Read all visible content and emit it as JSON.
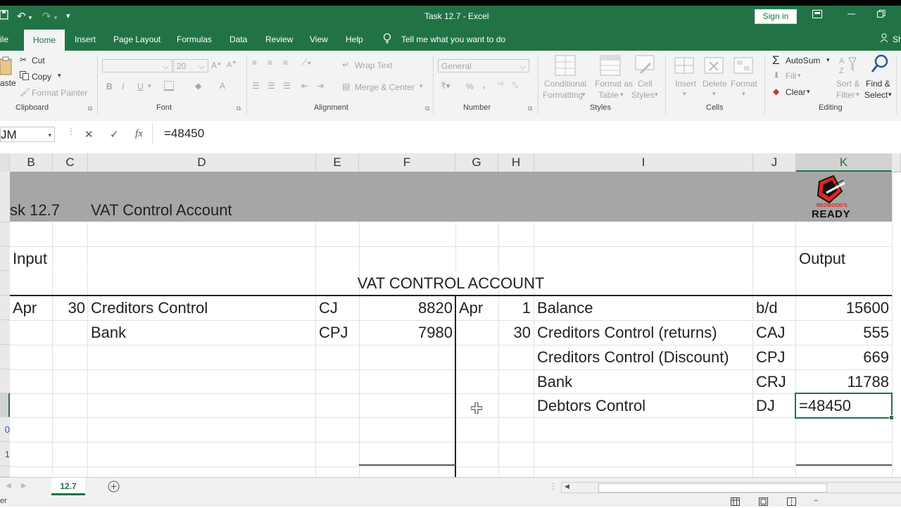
{
  "window": {
    "title": "Task 12.7  -  Excel",
    "sign_in": "Sign in"
  },
  "tabs": [
    "ile",
    "Home",
    "Insert",
    "Page Layout",
    "Formulas",
    "Data",
    "Review",
    "View",
    "Help"
  ],
  "tell_me": "Tell me what you want to do",
  "share": "Sh",
  "ribbon": {
    "paste": "aste",
    "cut": "Cut",
    "copy": "Copy",
    "format_painter": "Format Painter",
    "font_size": "20",
    "bold": "B",
    "italic": "I",
    "underline": "U",
    "wrap_text": "Wrap Text",
    "merge_center": "Merge & Center",
    "number_format": "General",
    "percent": "%",
    "comma": ",",
    "conditional": [
      "Conditional",
      "Formatting"
    ],
    "format_table": [
      "Format as",
      "Table"
    ],
    "cell_styles": [
      "Cell",
      "Styles"
    ],
    "insert": "Insert",
    "delete": "Delete",
    "format": "Format",
    "autosum": "AutoSum",
    "fill": "Fill",
    "clear": "Clear",
    "sort_filter": [
      "Sort &",
      "Filter"
    ],
    "find_select": [
      "Find &",
      "Select"
    ],
    "groups": [
      "Clipboard",
      "Font",
      "Alignment",
      "Number",
      "Styles",
      "Cells",
      "Editing"
    ]
  },
  "formula_bar": {
    "name_box": "JM",
    "formula": "=48450"
  },
  "columns": [
    "B",
    "C",
    "D",
    "E",
    "F",
    "G",
    "H",
    "I",
    "J",
    "K"
  ],
  "row_numbers": [
    "0",
    "1"
  ],
  "sheet": {
    "task_label": "sk 12.7",
    "task_title": "VAT Control Account",
    "logo_text": "REDWOOD'S",
    "logo_big": "READY",
    "input_label": "Input",
    "output_label": "Output",
    "account_heading": "VAT CONTROL ACCOUNT",
    "debit_rows": [
      {
        "month": "Apr",
        "day": "30",
        "details": "Creditors Control",
        "fol": "CJ",
        "amount": "8820"
      },
      {
        "month": "",
        "day": "",
        "details": "Bank",
        "fol": "CPJ",
        "amount": "7980"
      }
    ],
    "credit_rows": [
      {
        "month": "Apr",
        "day": "1",
        "details": "Balance",
        "fol": "b/d",
        "amount": "15600"
      },
      {
        "month": "",
        "day": "30",
        "details": "Creditors Control (returns)",
        "fol": "CAJ",
        "amount": "555"
      },
      {
        "month": "",
        "day": "",
        "details": "Creditors Control (Discount)",
        "fol": "CPJ",
        "amount": "669"
      },
      {
        "month": "",
        "day": "",
        "details": "Bank",
        "fol": "CRJ",
        "amount": "11788"
      },
      {
        "month": "",
        "day": "",
        "details": "Debtors Control",
        "fol": "DJ",
        "amount": "=48450"
      }
    ]
  },
  "sheet_tabs": {
    "active": "12.7"
  },
  "status": {
    "mode": "er"
  }
}
